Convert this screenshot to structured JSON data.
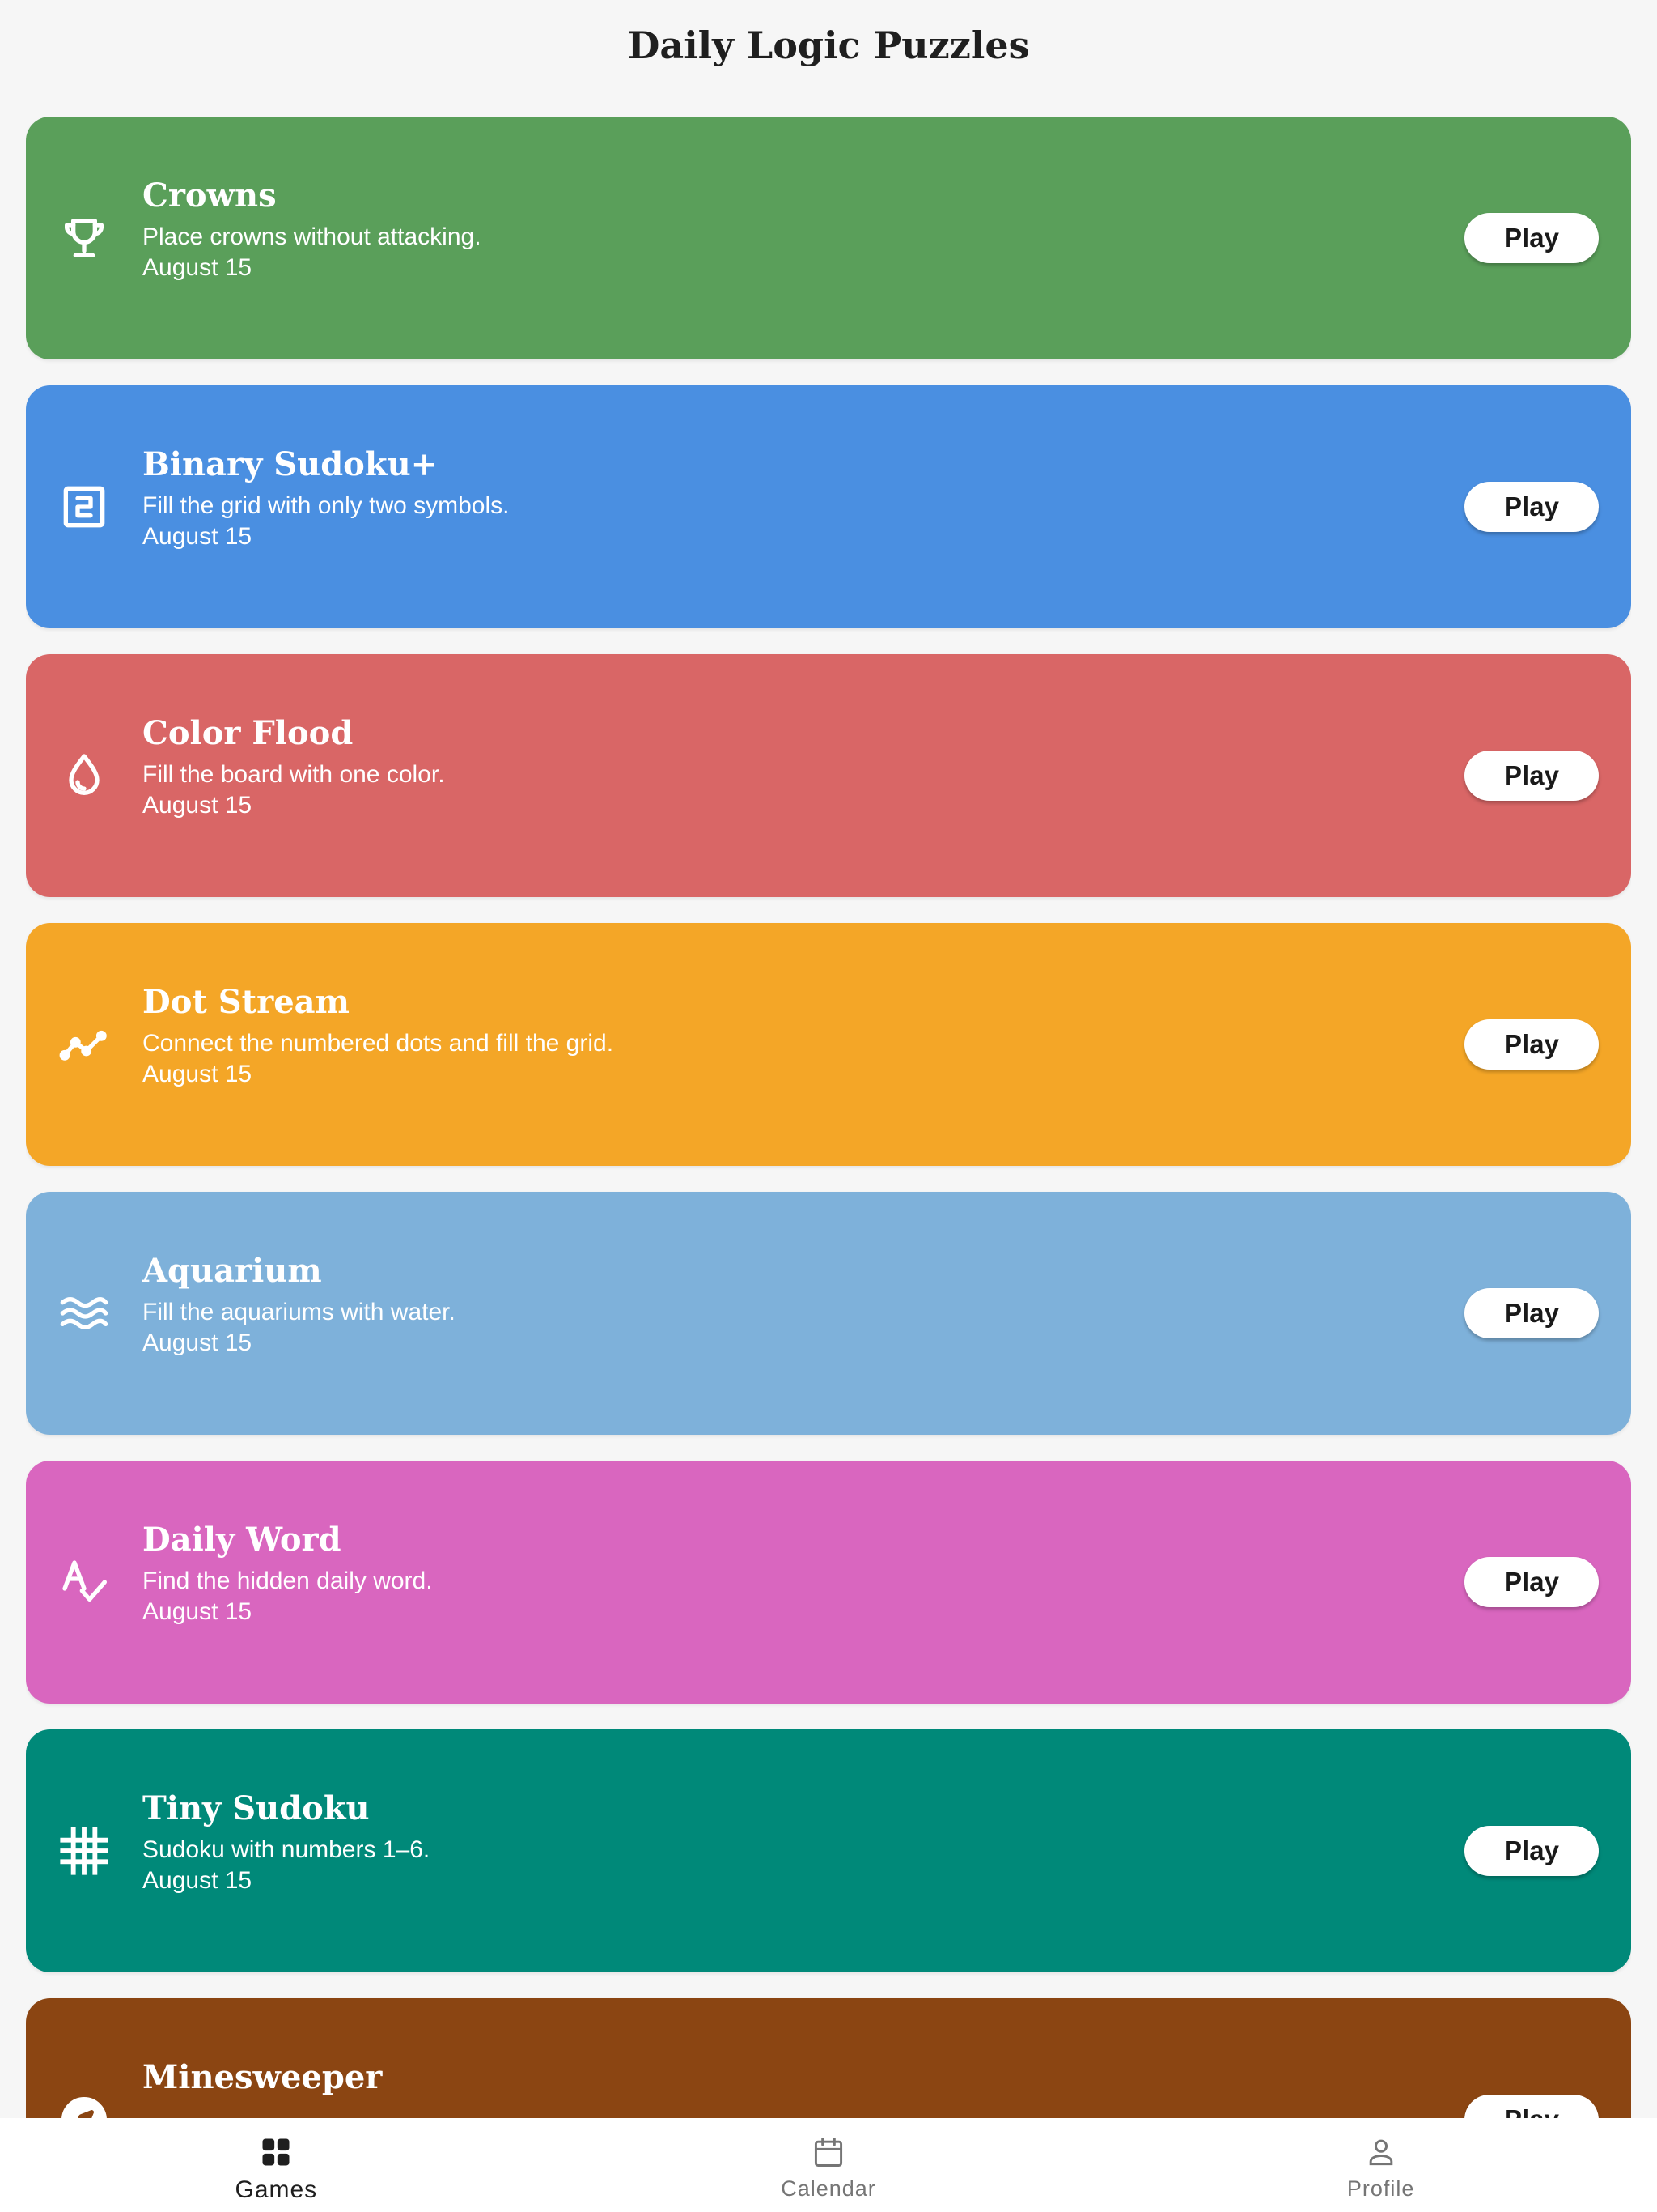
{
  "header": {
    "title": "Daily Logic Puzzles"
  },
  "games": [
    {
      "title": "Crowns",
      "description": "Place crowns without attacking.",
      "date": "August 15",
      "play_label": "Play",
      "color": "#5a9f5a",
      "icon": "trophy-icon"
    },
    {
      "title": "Binary Sudoku+",
      "description": "Fill the grid with only two symbols.",
      "date": "August 15",
      "play_label": "Play",
      "color": "#4a8fe1",
      "icon": "number-two-box-icon"
    },
    {
      "title": "Color Flood",
      "description": "Fill the board with one color.",
      "date": "August 15",
      "play_label": "Play",
      "color": "#d96666",
      "icon": "water-drop-icon"
    },
    {
      "title": "Dot Stream",
      "description": "Connect the numbered dots and fill the grid.",
      "date": "August 15",
      "play_label": "Play",
      "color": "#f4a627",
      "icon": "line-chart-icon"
    },
    {
      "title": "Aquarium",
      "description": "Fill the aquariums with water.",
      "date": "August 15",
      "play_label": "Play",
      "color": "#7eb1da",
      "icon": "waves-icon"
    },
    {
      "title": "Daily Word",
      "description": "Find the hidden daily word.",
      "date": "August 15",
      "play_label": "Play",
      "color": "#d966bf",
      "icon": "spellcheck-icon"
    },
    {
      "title": "Tiny Sudoku",
      "description": "Sudoku with numbers 1–6.",
      "date": "August 15",
      "play_label": "Play",
      "color": "#008979",
      "icon": "grid-icon"
    },
    {
      "title": "Minesweeper",
      "description": "",
      "date": "",
      "play_label": "Play",
      "color": "#8b4512",
      "icon": "compass-icon"
    }
  ],
  "bottom_nav": {
    "items": [
      {
        "label": "Games",
        "icon": "grid-four-icon",
        "active": true
      },
      {
        "label": "Calendar",
        "icon": "calendar-icon",
        "active": false
      },
      {
        "label": "Profile",
        "icon": "person-icon",
        "active": false
      }
    ]
  }
}
